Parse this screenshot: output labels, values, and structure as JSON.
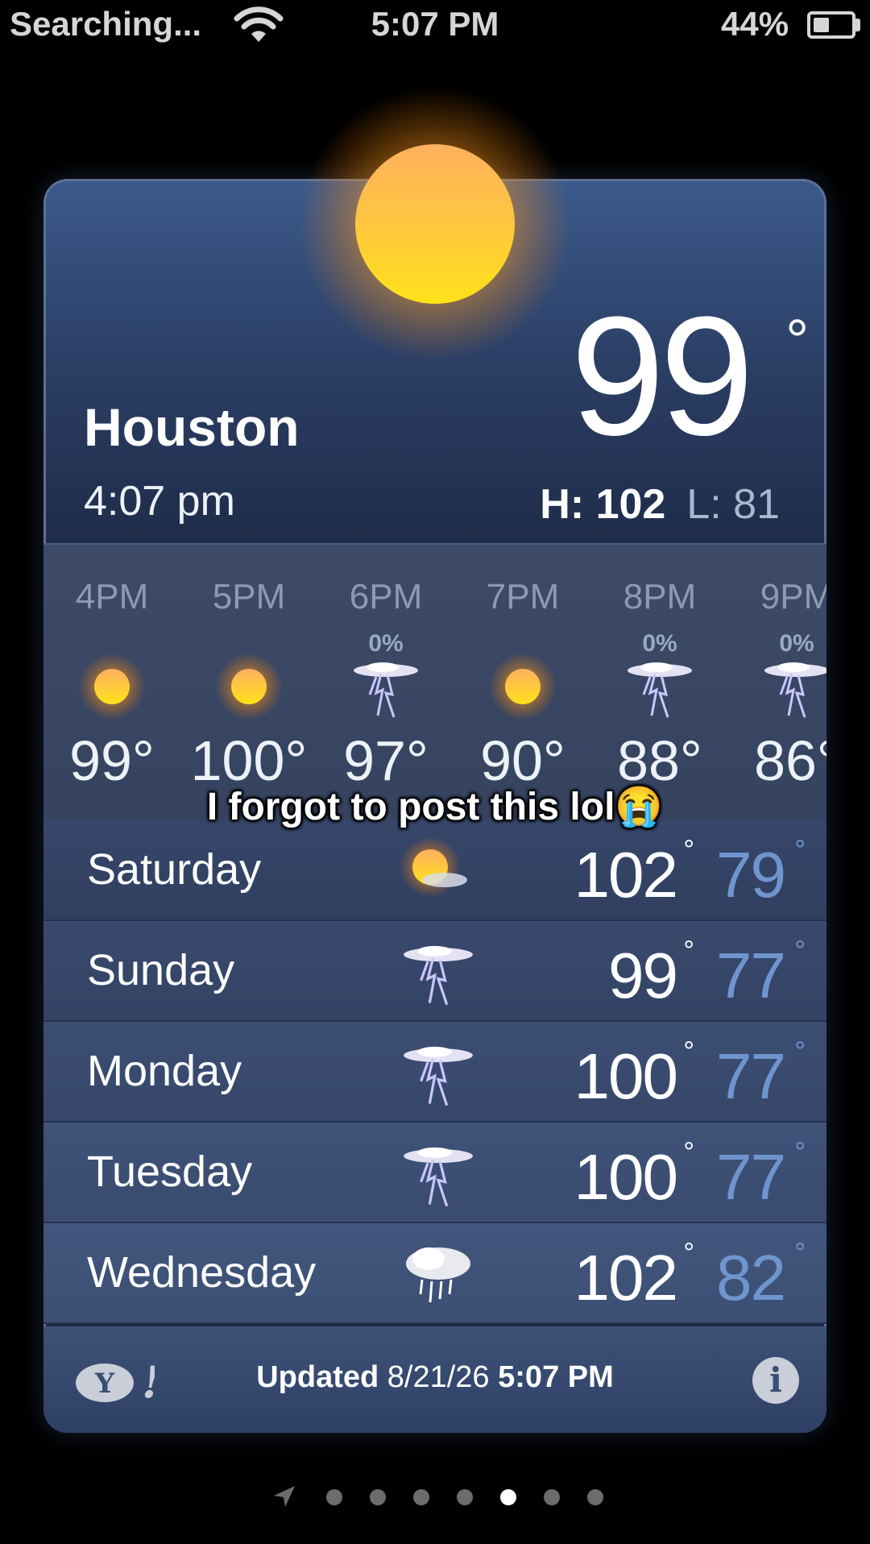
{
  "status_bar": {
    "carrier": "Searching...",
    "time": "5:07 PM",
    "battery_percent": "44%",
    "battery_level": 0.44
  },
  "weather": {
    "city": "Houston",
    "local_time": "4:07 pm",
    "current_temp": "99",
    "degree_symbol": "°",
    "high_label": "H: 102",
    "low_label": "L: 81",
    "hourly": [
      {
        "time": "4PM",
        "precip": "",
        "icon": "sun-icon",
        "temp": "99°"
      },
      {
        "time": "5PM",
        "precip": "",
        "icon": "sun-icon",
        "temp": "100°"
      },
      {
        "time": "6PM",
        "precip": "0%",
        "icon": "thunderstorm-icon",
        "temp": "97°"
      },
      {
        "time": "7PM",
        "precip": "",
        "icon": "sun-icon",
        "temp": "90°"
      },
      {
        "time": "8PM",
        "precip": "0%",
        "icon": "thunderstorm-icon",
        "temp": "88°"
      },
      {
        "time": "9PM",
        "precip": "0%",
        "icon": "thunderstorm-icon",
        "temp": "86°"
      }
    ],
    "daily": [
      {
        "day": "Saturday",
        "icon": "partly-cloudy-icon",
        "high": "102",
        "low": "79"
      },
      {
        "day": "Sunday",
        "icon": "thunderstorm-icon",
        "high": "99",
        "low": "77"
      },
      {
        "day": "Monday",
        "icon": "thunderstorm-icon",
        "high": "100",
        "low": "77"
      },
      {
        "day": "Tuesday",
        "icon": "thunderstorm-icon",
        "high": "100",
        "low": "77"
      },
      {
        "day": "Wednesday",
        "icon": "rain-cloud-icon",
        "high": "102",
        "low": "82"
      }
    ],
    "footer": {
      "updated_label": "Updated",
      "updated_date": "8/21/26",
      "updated_time": "5:07 PM",
      "yahoo_logo": "Y!",
      "info_glyph": "i"
    }
  },
  "caption": "I forgot to post this lol😭",
  "pager": {
    "page_count": 7,
    "active_index": 4
  },
  "colors": {
    "low_temp": "#6f95cf",
    "card_top": "#3b5a8c",
    "card_bottom": "#1c2742"
  }
}
